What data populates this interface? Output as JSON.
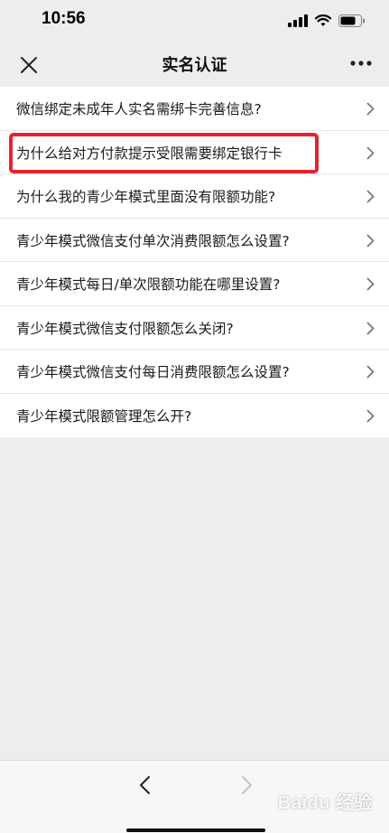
{
  "status_bar": {
    "time": "10:56",
    "icons": [
      "signal-icon",
      "wifi-icon",
      "battery-icon"
    ]
  },
  "nav": {
    "title": "实名认证",
    "close_icon": "close-icon",
    "more_icon": "more-icon"
  },
  "list": {
    "items": [
      {
        "label": "微信绑定未成年人实名需绑卡完善信息?"
      },
      {
        "label": "为什么给对方付款提示受限需要绑定银行卡"
      },
      {
        "label": "为什么我的青少年模式里面没有限额功能?"
      },
      {
        "label": "青少年模式微信支付单次消费限额怎么设置?"
      },
      {
        "label": "青少年模式每日/单次限额功能在哪里设置?"
      },
      {
        "label": "青少年模式微信支付限额怎么关闭?"
      },
      {
        "label": "青少年模式微信支付每日消费限额怎么设置?"
      },
      {
        "label": "青少年模式限额管理怎么开?"
      }
    ],
    "highlighted_index": 1,
    "highlight_color": "#e8222c"
  },
  "bottom_bar": {
    "back_icon": "chevron-left-icon",
    "forward_icon": "chevron-right-icon",
    "forward_enabled": false
  },
  "watermark": {
    "text": "Baidu 经验"
  }
}
